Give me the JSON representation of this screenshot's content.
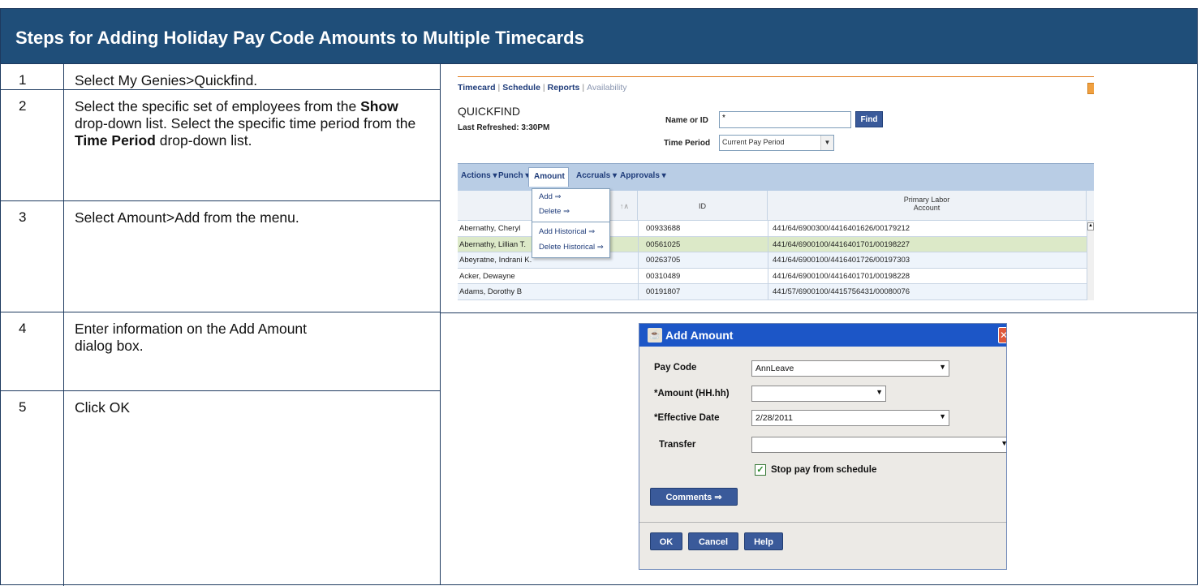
{
  "title": "Steps for Adding Holiday Pay Code Amounts to Multiple Timecards",
  "steps": [
    {
      "number": "1",
      "parts": [
        "Select My Genies>Quickfind."
      ]
    },
    {
      "number": "2",
      "parts": [
        "Select the specific set of employees from the ",
        "Show",
        " drop-down list. Select the specific time period from the ",
        "Time Period",
        " drop-down list."
      ]
    },
    {
      "number": "3",
      "parts": [
        "Select Amount>Add from the menu."
      ]
    },
    {
      "number": "4",
      "parts": [
        "Enter information on the Add Amount dialog box."
      ]
    },
    {
      "number": "5",
      "parts": [
        "Click OK"
      ]
    }
  ],
  "quickfind": {
    "nav": [
      "Timecard",
      "Schedule",
      "Reports",
      "Availability"
    ],
    "title": "QUICKFIND",
    "refresh": "Last Refreshed: 3:30PM",
    "name_label": "Name or ID",
    "name_value": "*",
    "find_button": "Find",
    "period_label": "Time Period",
    "period_value": "Current Pay Period",
    "menu": [
      "Actions ▾",
      "Punch ▾",
      "Amount",
      "Accruals ▾",
      "Approvals ▾"
    ],
    "dropdown": [
      "Add ⇒",
      "Delete ⇒",
      "Add Historical ⇒",
      "Delete Historical ⇒"
    ],
    "columns": {
      "sort": "↑∧",
      "id": "ID",
      "labor_line1": "Primary Labor",
      "labor_line2": "Account"
    },
    "rows": [
      {
        "name": "Abernathy, Cheryl",
        "id": "00933688",
        "account": "441/64/6900300/4416401626/00179212"
      },
      {
        "name": "Abernathy, Lillian T.",
        "id": "00561025",
        "account": "441/64/6900100/4416401701/00198227"
      },
      {
        "name": "Abeyratne, Indrani K.",
        "id": "00263705",
        "account": "441/64/6900100/4416401726/00197303"
      },
      {
        "name": "Acker, Dewayne",
        "id": "00310489",
        "account": "441/64/6900100/4416401701/00198228"
      },
      {
        "name": "Adams, Dorothy B",
        "id": "00191807",
        "account": "441/57/6900100/4415756431/00080076"
      }
    ],
    "colors": {
      "nav": "#1f3c7a",
      "toolbar": "#b9cde5",
      "highlight_row": "#dce9c8",
      "row_alt": "#eef4fb"
    }
  },
  "dialog": {
    "title": "Add Amount",
    "pay_code_label": "Pay Code",
    "pay_code_value": "AnnLeave",
    "amount_label": "*Amount (HH.hh)",
    "amount_value": "",
    "date_label": "*Effective Date",
    "date_value": "2/28/2011",
    "transfer_label": "Transfer",
    "transfer_value": "",
    "checkbox_label": "Stop pay from schedule",
    "checkbox_checked": true,
    "comments_button": "Comments ⇒",
    "ok_button": "OK",
    "cancel_button": "Cancel",
    "help_button": "Help",
    "colors": {
      "titlebar": "#1c56c7",
      "button": "#3a5a9a"
    }
  }
}
